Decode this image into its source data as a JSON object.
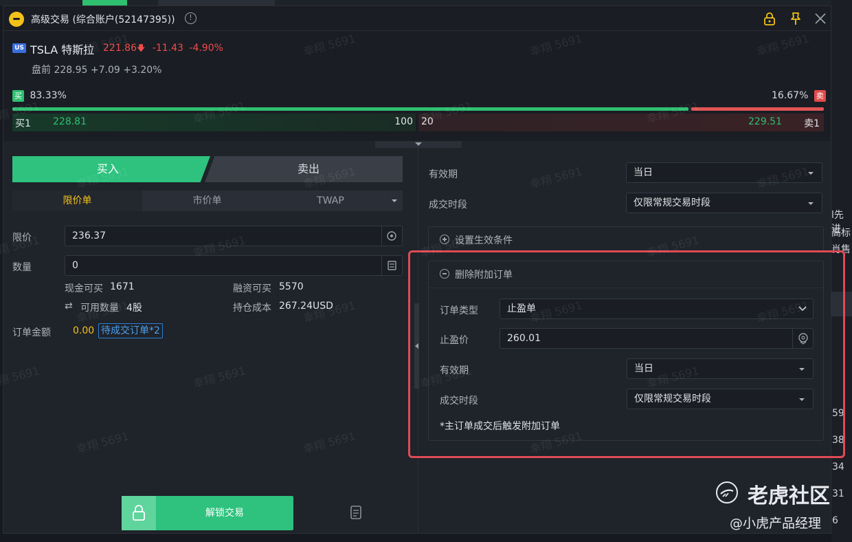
{
  "window": {
    "title": "高级交易 (综合账户(52147395))"
  },
  "quote": {
    "market_badge": "US",
    "symbol_name": "TSLA 特斯拉",
    "last": "221.86",
    "change": "-11.43",
    "change_pct": "-4.90%",
    "premarket": "盘前 228.95 +7.09 +3.20%",
    "buy_tag": "买",
    "buy_ratio": "83.33%",
    "buy_ratio_value": 0.8333,
    "sell_ratio": "16.67%",
    "sell_tag": "卖",
    "bid_label": "买1",
    "bid_price": "228.81",
    "bid_size": "100",
    "ask_size": "20",
    "ask_price": "229.51",
    "ask_label": "卖1"
  },
  "order": {
    "buy_tab": "买入",
    "sell_tab": "卖出",
    "types": [
      "限价单",
      "市价单",
      "TWAP"
    ],
    "limit_label": "限价",
    "limit_value": "236.37",
    "qty_label": "数量",
    "qty_value": "0",
    "cash_buy_label": "现金可买",
    "cash_buy_value": "1671",
    "margin_buy_label": "融资可买",
    "margin_buy_value": "5570",
    "avail_qty_label": "可用数量",
    "avail_qty_value": "4股",
    "cost_label": "持仓成本",
    "cost_value": "267.24USD",
    "amount_label": "订单金额",
    "amount_value": "0.00",
    "pending_label": "待成交订单*2",
    "unlock_label": "解锁交易"
  },
  "settings": {
    "validity_label": "有效期",
    "validity_value": "当日",
    "session_label": "成交时段",
    "session_value": "仅限常规交易时段",
    "condition_label": "设置生效条件",
    "attach": {
      "header": "删除附加订单",
      "type_label": "订单类型",
      "type_value": "止盈单",
      "tp_label": "止盈价",
      "tp_value": "260.01",
      "validity_label": "有效期",
      "validity_value": "当日",
      "session_label": "成交时段",
      "session_value": "仅限常规交易时段",
      "note": "*主订单成交后触发附加订单"
    }
  },
  "watermark": "幸翔 5691",
  "overlay": {
    "brand": "老虎社区",
    "author": "@小虎产品经理"
  },
  "background": {
    "side_numbers": [
      "59",
      "38",
      "34",
      "31",
      "6"
    ],
    "side_text": [
      "l先进",
      "高标",
      "肖售"
    ]
  },
  "colors": {
    "buy": "#2ec27e",
    "sell": "#e05555",
    "highlight": "#e04b55"
  }
}
